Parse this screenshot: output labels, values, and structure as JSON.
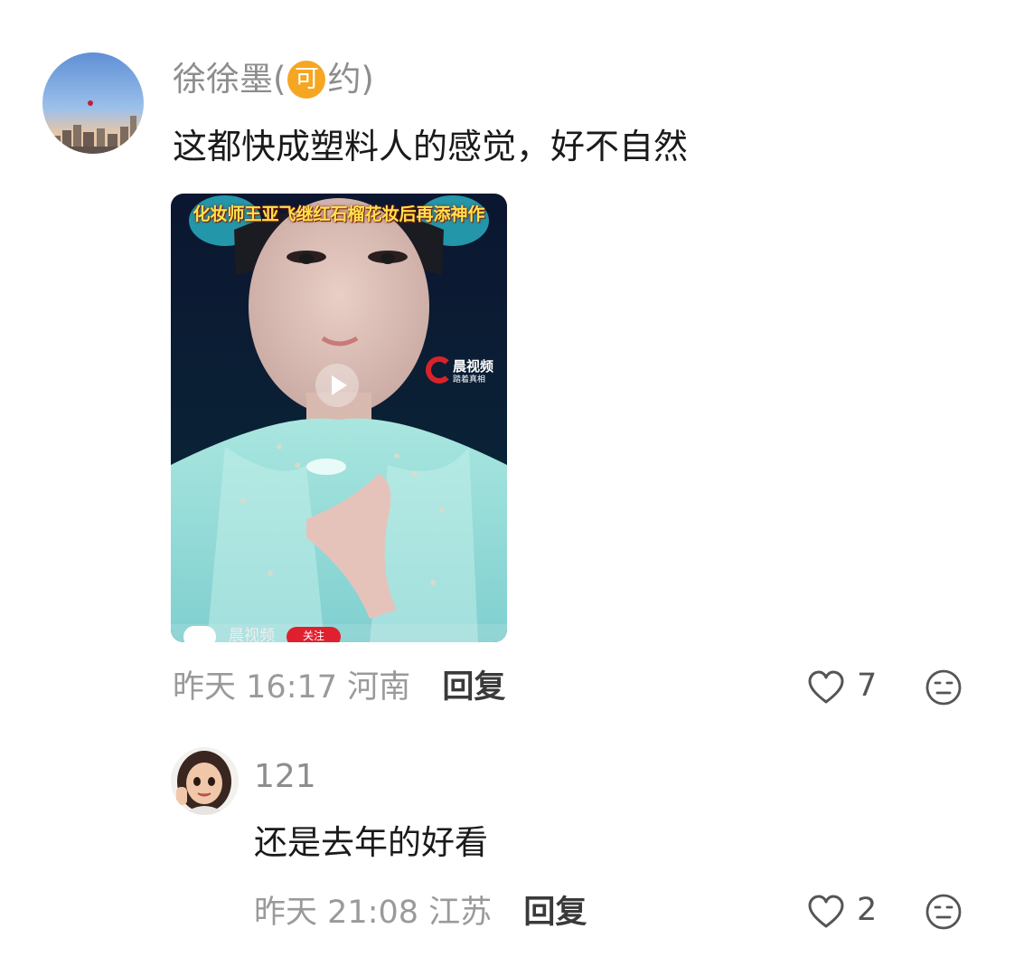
{
  "comment": {
    "username_main": "徐徐墨(",
    "badge": "可",
    "username_suffix": "约)",
    "text": "这都快成塑料人的感觉，好不自然",
    "video": {
      "banner": "化妆师王亚飞继红石榴花妆后再添神作",
      "watermark_name": "晨视频",
      "watermark_sub": "踏着真相",
      "channel_name": "晨视频",
      "follow_label": "关注"
    },
    "date": "昨天",
    "time": "16:17",
    "location": "河南",
    "reply_label": "回复",
    "likes": "7",
    "icons": [
      "heart-icon",
      "emoji-icon"
    ]
  },
  "reply": {
    "username": "121",
    "text": "还是去年的好看",
    "date": "昨天",
    "time": "21:08",
    "location": "江苏",
    "reply_label": "回复",
    "likes": "2",
    "icons": [
      "heart-icon",
      "emoji-icon"
    ]
  },
  "colors": {
    "badge": "#f5a623",
    "meta": "#9a9a9a",
    "username": "#8d8d8d",
    "text": "#1a1a1a",
    "follow": "#e0202e"
  }
}
